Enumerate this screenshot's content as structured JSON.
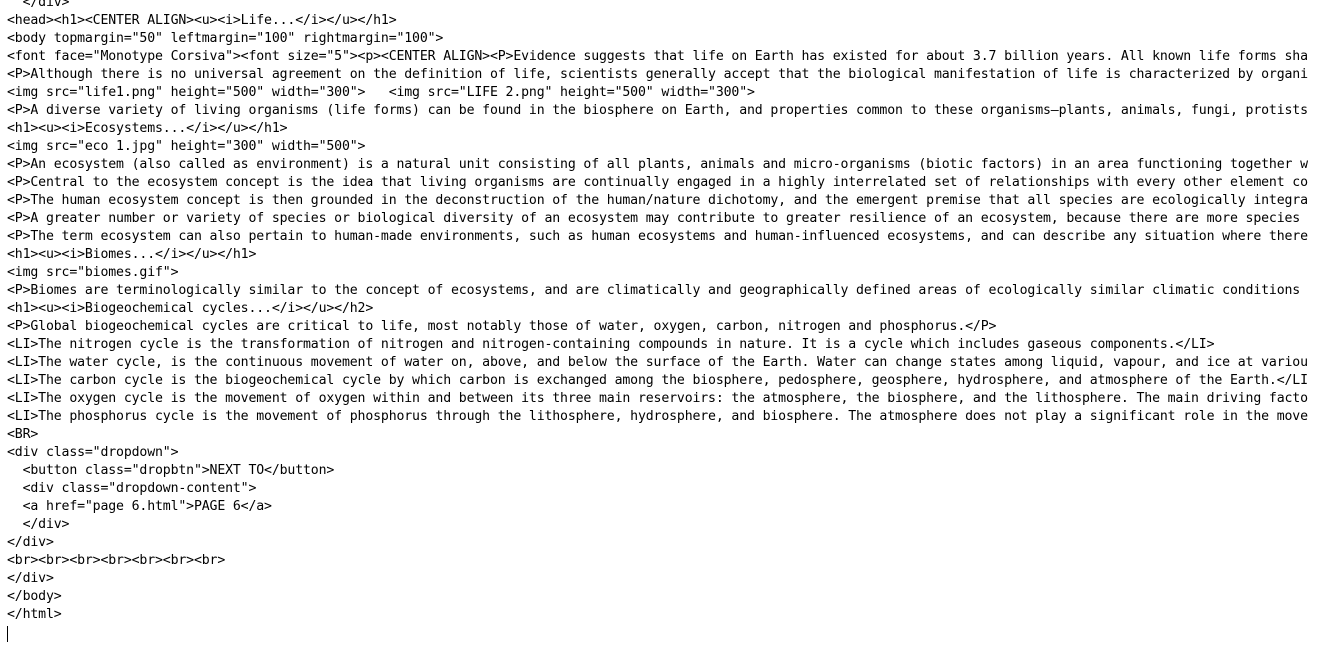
{
  "editor": {
    "lines": [
      "  </div>",
      "<head><h1><CENTER ALIGN><u><i>Life...</i></u></h1>",
      "<body topmargin=\"50\" leftmargin=\"100\" rightmargin=\"100\">",
      "<font face=\"Monotype Corsiva\"><font size=\"5\"><p><CENTER ALIGN><P>Evidence suggests that life on Earth has existed for about 3.7 billion years. All known life forms sha",
      "<P>Although there is no universal agreement on the definition of life, scientists generally accept that the biological manifestation of life is characterized by organi",
      "<img src=\"life1.png\" height=\"500\" width=\"300\">   <img src=\"LIFE 2.png\" height=\"500\" width=\"300\">",
      "<P>A diverse variety of living organisms (life forms) can be found in the biosphere on Earth, and properties common to these organisms—plants, animals, fungi, protists",
      "<h1><u><i>Ecosystems...</i></u></h1>",
      "<img src=\"eco 1.jpg\" height=\"300\" width=\"500\">",
      "<P>An ecosystem (also called as environment) is a natural unit consisting of all plants, animals and micro-organisms (biotic factors) in an area functioning together w",
      "<P>Central to the ecosystem concept is the idea that living organisms are continually engaged in a highly interrelated set of relationships with every other element co",
      "<P>The human ecosystem concept is then grounded in the deconstruction of the human/nature dichotomy, and the emergent premise that all species are ecologically integra",
      "<P>A greater number or variety of species or biological diversity of an ecosystem may contribute to greater resilience of an ecosystem, because there are more species",
      "<P>The term ecosystem can also pertain to human-made environments, such as human ecosystems and human-influenced ecosystems, and can describe any situation where there",
      "<h1><u><i>Biomes...</i></u></h1>",
      "<img src=\"biomes.gif\">",
      "<P>Biomes are terminologically similar to the concept of ecosystems, and are climatically and geographically defined areas of ecologically similar climatic conditions",
      "<h1><u><i>Biogeochemical cycles...</i></u></h2>",
      "<P>Global biogeochemical cycles are critical to life, most notably those of water, oxygen, carbon, nitrogen and phosphorus.</P>",
      "<LI>The nitrogen cycle is the transformation of nitrogen and nitrogen-containing compounds in nature. It is a cycle which includes gaseous components.</LI>",
      "<LI>The water cycle, is the continuous movement of water on, above, and below the surface of the Earth. Water can change states among liquid, vapour, and ice at variou",
      "<LI>The carbon cycle is the biogeochemical cycle by which carbon is exchanged among the biosphere, pedosphere, geosphere, hydrosphere, and atmosphere of the Earth.</LI",
      "<LI>The oxygen cycle is the movement of oxygen within and between its three main reservoirs: the atmosphere, the biosphere, and the lithosphere. The main driving facto",
      "<LI>The phosphorus cycle is the movement of phosphorus through the lithosphere, hydrosphere, and biosphere. The atmosphere does not play a significant role in the move",
      "<BR>",
      "<div class=\"dropdown\">",
      "  <button class=\"dropbtn\">NEXT TO</button>",
      "  <div class=\"dropdown-content\">",
      "  <a href=\"page 6.html\">PAGE 6</a>",
      "  </div>",
      "</div>",
      "<br><br><br><br><br><br><br>",
      "</div>",
      "</body>",
      "</html>"
    ]
  }
}
